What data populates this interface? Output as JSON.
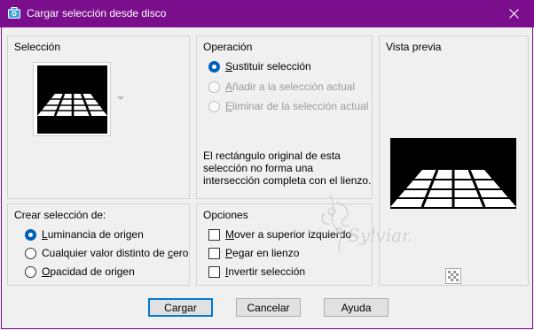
{
  "window": {
    "title": "Cargar selección desde disco",
    "title_icon": "camera-icon",
    "close_icon": "close-icon",
    "accent_color": "#7a0e8c"
  },
  "seleccion": {
    "label": "Selección"
  },
  "operacion": {
    "label": "Operación",
    "options": [
      {
        "key": "S",
        "rest": "ustituir selección",
        "checked": true,
        "enabled": true
      },
      {
        "key": "A",
        "rest": "ñadir a la selección actual",
        "checked": false,
        "enabled": false
      },
      {
        "key": "E",
        "rest": "liminar de la selección actual",
        "checked": false,
        "enabled": false
      }
    ],
    "info_text": "El rectángulo original de esta selección no forma una intersección completa con el lienzo."
  },
  "vista_previa": {
    "label": "Vista previa",
    "transparency_icon": "checkerboard-icon"
  },
  "crear": {
    "label": "Crear selección de:",
    "options": [
      {
        "key": "L",
        "rest": "uminancia de origen",
        "checked": true
      },
      {
        "pre": "Cualquier valor distinto de ",
        "key": "c",
        "rest": "ero",
        "checked": false
      },
      {
        "key": "O",
        "rest": "pacidad de origen",
        "checked": false
      }
    ]
  },
  "opciones": {
    "label": "Opciones",
    "checks": [
      {
        "key": "M",
        "rest": "over a superior izquierdo",
        "checked": false
      },
      {
        "key": "P",
        "rest": "egar en lienzo",
        "checked": false
      },
      {
        "key": "I",
        "rest": "nvertir selección",
        "checked": false
      }
    ]
  },
  "buttons": {
    "load": "Cargar",
    "cancel": "Cancelar",
    "help": "Ayuda"
  },
  "watermark": {
    "text": "Sylviane"
  }
}
